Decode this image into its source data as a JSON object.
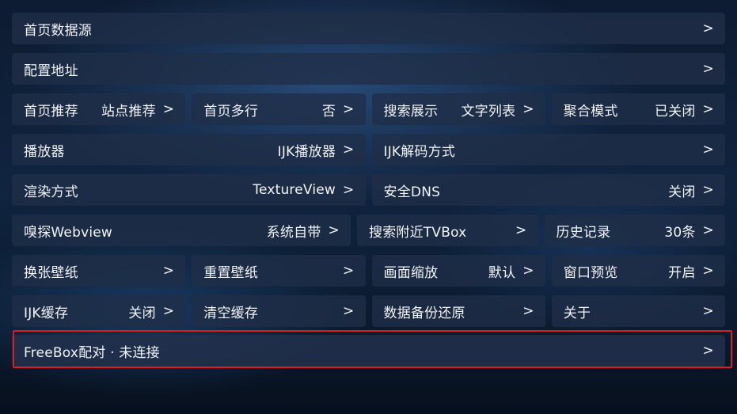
{
  "rows": [
    [
      {
        "label": "首页数据源",
        "value": "",
        "chevron": ">"
      }
    ],
    [
      {
        "label": "配置地址",
        "value": "",
        "chevron": ">"
      }
    ],
    [
      {
        "label": "首页推荐",
        "value": "站点推荐",
        "chevron": ">"
      },
      {
        "label": "首页多行",
        "value": "否",
        "chevron": ">"
      },
      {
        "label": "搜索展示",
        "value": "文字列表",
        "chevron": ">"
      },
      {
        "label": "聚合模式",
        "value": "已关闭",
        "chevron": ">"
      }
    ],
    [
      {
        "label": "播放器",
        "value": "IJK播放器",
        "chevron": ">"
      },
      {
        "label": "IJK解码方式",
        "value": "",
        "chevron": ">"
      }
    ],
    [
      {
        "label": "渲染方式",
        "value": "TextureView",
        "chevron": ">"
      },
      {
        "label": "安全DNS",
        "value": "关闭",
        "chevron": ">"
      }
    ],
    [
      {
        "label": "嗅探Webview",
        "value": "系统自带",
        "chevron": ">"
      },
      {
        "label": "搜索附近TVBox",
        "value": "",
        "chevron": ">"
      },
      {
        "label": "历史记录",
        "value": "30条",
        "chevron": ">"
      }
    ],
    [
      {
        "label": "换张壁纸",
        "value": "",
        "chevron": ">"
      },
      {
        "label": "重置壁纸",
        "value": "",
        "chevron": ">"
      },
      {
        "label": "画面缩放",
        "value": "默认",
        "chevron": ">"
      },
      {
        "label": "窗口预览",
        "value": "开启",
        "chevron": ">"
      }
    ],
    [
      {
        "label": "IJK缓存",
        "value": "关闭",
        "chevron": ">"
      },
      {
        "label": "清空缓存",
        "value": "",
        "chevron": ">"
      },
      {
        "label": "数据备份还原",
        "value": "",
        "chevron": ">"
      },
      {
        "label": "关于",
        "value": "",
        "chevron": ">"
      }
    ],
    [
      {
        "label": "FreeBox配对 · 未连接",
        "value": "",
        "chevron": ">"
      }
    ]
  ],
  "focus_color": "#e01b1b"
}
